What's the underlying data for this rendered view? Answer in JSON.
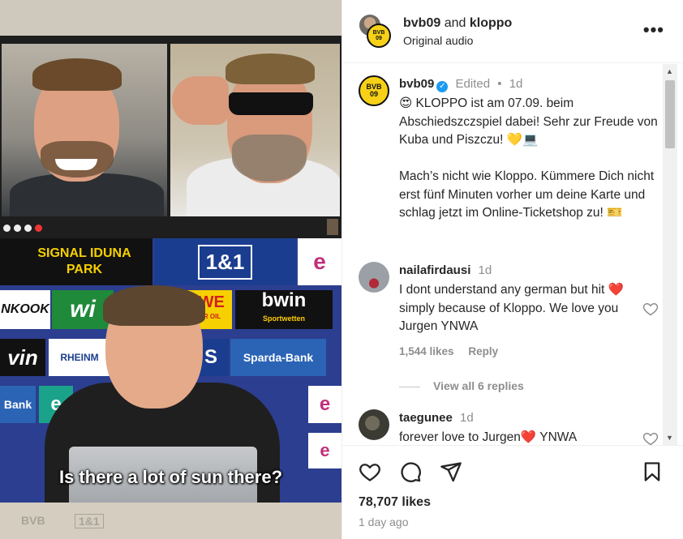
{
  "post": {
    "header": {
      "user1": "bvb09",
      "and_text": "and",
      "user2": "kloppo",
      "audio": "Original audio",
      "more_label": "•••"
    },
    "media": {
      "subtitle": "Is there a lot of sun there?",
      "sponsors": {
        "signal_iduna": "SIGNAL IDUNA",
        "park": "PARK",
        "one_and_one": "1&1",
        "nkook": "NKOOK",
        "wi": "wi",
        "owe": "OWE",
        "otor_oil": "OTOR OIL",
        "bwin": "bwin",
        "sportwetten": "Sportwetten",
        "vin": "vin",
        "rheinm": "RHEINM",
        "s": "S",
        "sparda": "Sparda-Bank",
        "bank": "Bank",
        "e": "e"
      },
      "bottom_logos": [
        "BVB",
        "1&1"
      ]
    },
    "caption": {
      "username": "bvb09",
      "verified_glyph": "✓",
      "edited": "Edited",
      "dot": "•",
      "time": "1d",
      "text": "😍 KLOPPO ist am 07.09. beim Abschiedszczspiel dabei! Sehr zur Freude von Kuba und Piszczu! 💛💻\n\nMach’s nicht wie Kloppo. Kümmere Dich nicht erst fünf Minuten vorher um deine Karte und schlag jetzt im Online-Ticketshop zu! 🎫"
    },
    "comments": [
      {
        "username": "nailafirdausi",
        "time": "1d",
        "text_before": "I dont understand any german but hit ",
        "heart": "❤️",
        "text_after": " simply because of Kloppo. We love you Jurgen YNWA",
        "likes": "1,544 likes",
        "reply": "Reply",
        "view_replies": "View all 6 replies"
      },
      {
        "username": "taegunee",
        "time": "1d",
        "text_before": "forever love to Jurgen",
        "heart": "❤️",
        "text_after": " YNWA"
      }
    ],
    "likes_count": "78,707 likes",
    "posted_ago": "1 day ago"
  },
  "logo_text": {
    "bvb": "BVB",
    "num": "09"
  },
  "colors": {
    "bvb_yellow": "#f7d117",
    "verified_blue": "#1d9bf0",
    "heart_red": "#e0245e",
    "muted_text": "#8e8e8e"
  },
  "icons": [
    "heart-icon",
    "comment-icon",
    "share-icon",
    "bookmark-icon",
    "more-icon",
    "verified-icon",
    "scroll-up-arrow-icon",
    "scroll-down-arrow-icon"
  ]
}
